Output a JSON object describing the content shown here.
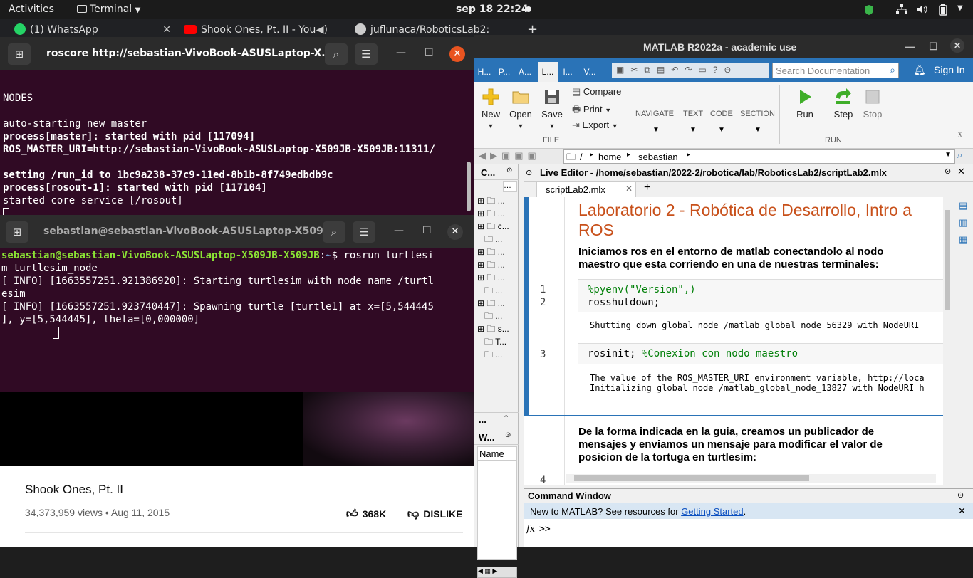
{
  "topbar": {
    "activities": "Activities",
    "app_menu": "Terminal",
    "clock": "sep 18  22:24"
  },
  "browser": {
    "tabs": [
      {
        "label": "(1) WhatsApp"
      },
      {
        "label": "Shook Ones, Pt. II - You"
      },
      {
        "label": "juflunaca/RoboticsLab2:"
      }
    ],
    "new_tab": "+"
  },
  "youtube": {
    "video_title": "Shook Ones, Pt. II",
    "meta": "34,373,959 views • Aug 11, 2015",
    "likes": "368K",
    "dislike": "DISLIKE"
  },
  "terminal1": {
    "title": "roscore http://sebastian-VivoBook-ASUSLaptop-X...",
    "lines": [
      "",
      "NODES",
      "",
      "auto-starting new master",
      "process[master]: started with pid [117094]",
      "ROS_MASTER_URI=http://sebastian-VivoBook-ASUSLaptop-X509JB-X509JB:11311/",
      "",
      "setting /run_id to 1bc9a238-37c9-11ed-8b1b-8f749edbdb9c",
      "process[rosout-1]: started with pid [117104]",
      "started core service [/rosout]"
    ]
  },
  "terminal2": {
    "title": "sebastian@sebastian-VivoBook-ASUSLaptop-X509...",
    "prompt_user": "sebastian@sebastian-VivoBook-ASUSLaptop-X509JB-X509JB",
    "prompt_path": "~",
    "prompt_cmd": "$ rosrun turtlesi",
    "lines": [
      "m turtlesim_node",
      "[ INFO] [1663557251.921386920]: Starting turtlesim with node name /turtl",
      "esim",
      "[ INFO] [1663557251.923740447]: Spawning turtle [turtle1] at x=[5,544445",
      "], y=[5,544445], theta=[0,000000]"
    ]
  },
  "matlab": {
    "title": "MATLAB R2022a - academic use",
    "tabs": [
      "H...",
      "P...",
      "A...",
      "L...",
      "I...",
      "V..."
    ],
    "search_placeholder": "Search Documentation",
    "sign_in": "Sign In",
    "ribbon": {
      "new": "New",
      "open": "Open",
      "save": "Save",
      "compare": "Compare",
      "print": "Print",
      "export": "Export",
      "file_group": "FILE",
      "navigate": "NAVIGATE",
      "text": "TEXT",
      "code": "CODE",
      "section": "SECTION",
      "run": "Run",
      "step": "Step",
      "stop": "Stop",
      "run_group": "RUN"
    },
    "address": [
      "/",
      "home",
      "sebastian"
    ],
    "current_folder_label": "C...",
    "workspace_label": "W...",
    "workspace_col": "Name",
    "folder_items": [
      "...",
      "...",
      "c...",
      "...",
      "...",
      "...",
      "...",
      "...",
      "...",
      "s...",
      "T...",
      "..."
    ],
    "editor_title": "Live Editor - /home/sebastian/2022-2/robotica/lab/RoboticsLab2/scriptLab2.mlx",
    "editor_tab": "scriptLab2.mlx",
    "heading": "Laboratorio 2 - Robótica de Desarrollo, Intro a ROS",
    "para1": "Iniciamos ros en el entorno de matlab conectandolo al nodo maestro que esta corriendo en una de nuestras terminales:",
    "code1_l1_comment": "%pyenv(\"Version\",)",
    "code1_l2": "rosshutdown;",
    "out1": "Shutting down global node /matlab_global_node_56329 with NodeURI",
    "code2": "rosinit; ",
    "code2_comment": "%Conexion con nodo maestro",
    "out2_l1": "The value of the ROS_MASTER_URI environment variable, http://loca",
    "out2_l2": "Initializing global node /matlab_global_node_13827 with NodeURI h",
    "para2": "De la forma indicada en la guia, creamos un publicador de mensajes y enviamos un mensaje para modificar el valor de posicion de la tortuga en turtlesim:",
    "line_numbers": [
      "1",
      "2",
      "3",
      "4"
    ],
    "command_window": "Command Window",
    "new_to_matlab": "New to MATLAB? See resources for ",
    "getting_started": "Getting Started",
    "prompt": ">>",
    "fx": "fx"
  }
}
